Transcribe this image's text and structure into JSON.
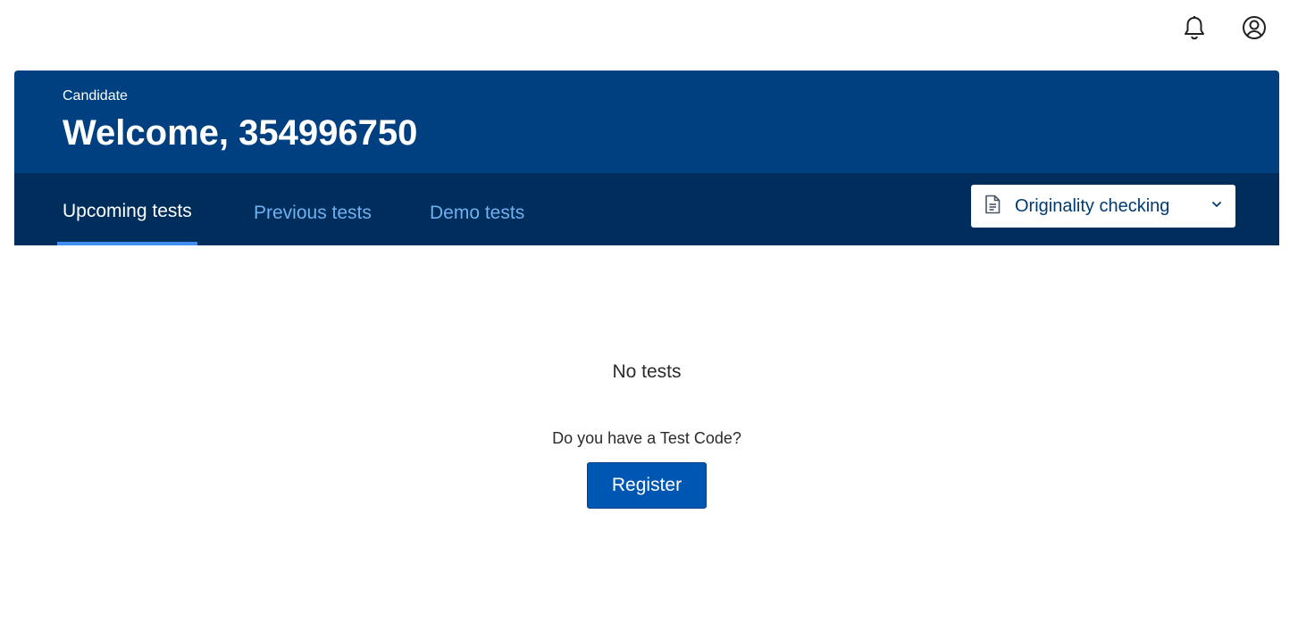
{
  "header": {
    "icons": [
      "bell-icon",
      "user-circle-icon"
    ]
  },
  "hero": {
    "role_label": "Candidate",
    "welcome_text": "Welcome, 354996750"
  },
  "tabs": [
    {
      "label": "Upcoming tests",
      "active": true
    },
    {
      "label": "Previous tests",
      "active": false
    },
    {
      "label": "Demo tests",
      "active": false
    }
  ],
  "dropdown": {
    "selected": "Originality checking",
    "icon": "document-icon"
  },
  "empty_state": {
    "title": "No tests",
    "prompt": "Do you have a Test Code?",
    "button_label": "Register"
  },
  "colors": {
    "hero_primary": "#004080",
    "hero_dark": "#002e5c",
    "tab_active_underline": "#3f8ff0",
    "tab_inactive_text": "#6fb0f0",
    "button_bg": "#0057b3"
  }
}
